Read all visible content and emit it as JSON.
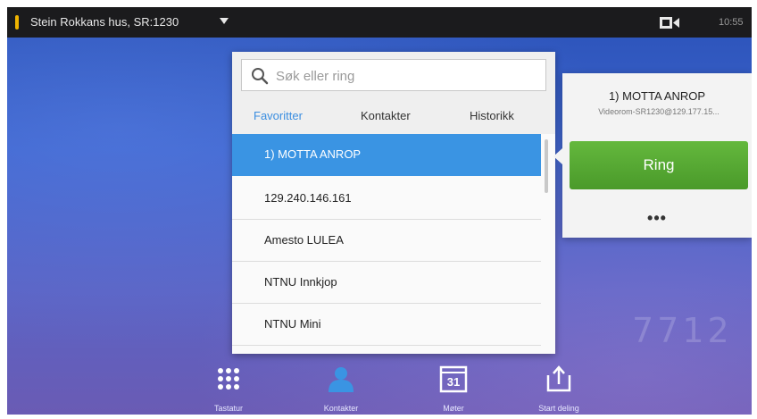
{
  "topbar": {
    "room_title": "Stein Rokkans hus, SR:1230",
    "clock": "10:55",
    "icons": {
      "menu_caret": "chevron-down-icon",
      "camera": "camera-icon"
    },
    "accent_color": "#f0b400"
  },
  "contacts": {
    "search": {
      "placeholder": "Søk eller ring",
      "value": ""
    },
    "tabs": [
      {
        "label": "Favoritter",
        "active": true
      },
      {
        "label": "Kontakter",
        "active": false
      },
      {
        "label": "Historikk",
        "active": false
      }
    ],
    "items": [
      {
        "label": "1) MOTTA ANROP",
        "selected": true
      },
      {
        "label": "129.240.146.161",
        "selected": false
      },
      {
        "label": "Amesto LULEA",
        "selected": false
      },
      {
        "label": "NTNU Innkjop",
        "selected": false
      },
      {
        "label": "NTNU Mini",
        "selected": false
      }
    ],
    "selected_color": "#3a94e3"
  },
  "detail": {
    "name": "1) MOTTA ANROP",
    "uri": "Videorom-SR1230@129.177.15...",
    "call_label": "Ring",
    "more_label": "•••",
    "call_color": "#4a9a2a"
  },
  "dock": [
    {
      "label": "Tastatur",
      "icon": "keypad-icon"
    },
    {
      "label": "Kontakter",
      "icon": "contacts-icon"
    },
    {
      "label": "Møter",
      "icon": "calendar-icon",
      "day": "31"
    },
    {
      "label": "Start deling",
      "icon": "share-icon"
    }
  ]
}
